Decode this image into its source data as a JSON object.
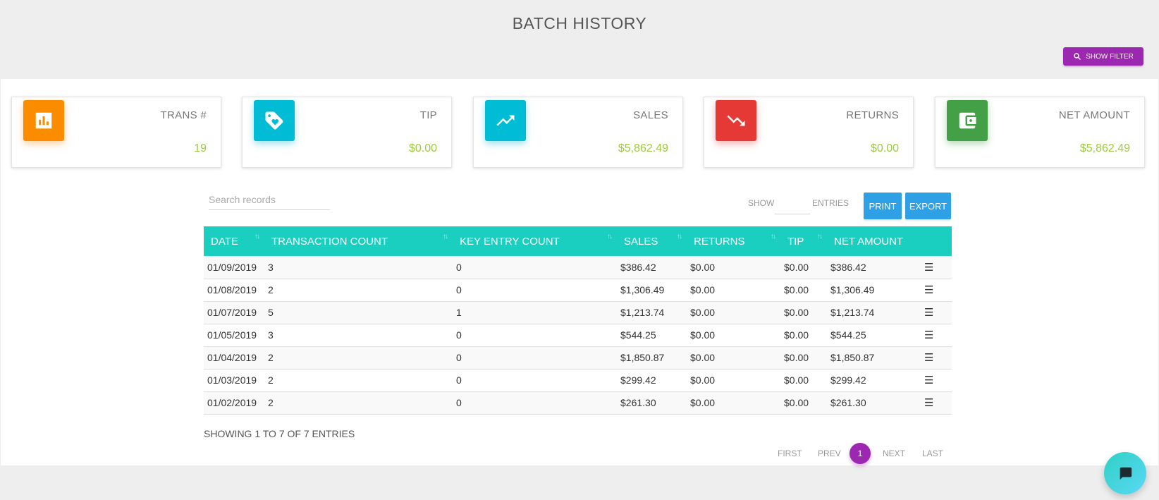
{
  "header": {
    "title": "BATCH HISTORY",
    "filter_button": "SHOW FILTER"
  },
  "cards": [
    {
      "label": "TRANS #",
      "value": "19",
      "icon": "bar-chart-icon",
      "color": "#fb8c00"
    },
    {
      "label": "TIP",
      "value": "$0.00",
      "icon": "tag-heart-icon",
      "color": "#00bcd4"
    },
    {
      "label": "SALES",
      "value": "$5,862.49",
      "icon": "trending-up-icon",
      "color": "#00bcd4"
    },
    {
      "label": "RETURNS",
      "value": "$0.00",
      "icon": "trending-down-icon",
      "color": "#e53935"
    },
    {
      "label": "NET AMOUNT",
      "value": "$5,862.49",
      "icon": "wallet-icon",
      "color": "#43a047"
    }
  ],
  "toolbar": {
    "search_placeholder": "Search records",
    "show_label": "SHOW",
    "entries_label": "ENTRIES",
    "print_label": "PRINT",
    "export_label": "EXPORT"
  },
  "table": {
    "columns": [
      "DATE",
      "TRANSACTION COUNT",
      "KEY ENTRY COUNT",
      "SALES",
      "RETURNS",
      "TIP",
      "NET AMOUNT"
    ],
    "rows": [
      [
        "01/09/2019",
        "3",
        "0",
        "$386.42",
        "$0.00",
        "$0.00",
        "$386.42"
      ],
      [
        "01/08/2019",
        "2",
        "0",
        "$1,306.49",
        "$0.00",
        "$0.00",
        "$1,306.49"
      ],
      [
        "01/07/2019",
        "5",
        "1",
        "$1,213.74",
        "$0.00",
        "$0.00",
        "$1,213.74"
      ],
      [
        "01/05/2019",
        "3",
        "0",
        "$544.25",
        "$0.00",
        "$0.00",
        "$544.25"
      ],
      [
        "01/04/2019",
        "2",
        "0",
        "$1,850.87",
        "$0.00",
        "$0.00",
        "$1,850.87"
      ],
      [
        "01/03/2019",
        "2",
        "0",
        "$299.42",
        "$0.00",
        "$0.00",
        "$299.42"
      ],
      [
        "01/02/2019",
        "2",
        "0",
        "$261.30",
        "$0.00",
        "$0.00",
        "$261.30"
      ]
    ],
    "row_menu_glyph": "☰"
  },
  "footer": {
    "showing_text": "SHOWING 1 TO 7 OF 7 ENTRIES",
    "first": "FIRST",
    "prev": "PREV",
    "current_page": "1",
    "next": "NEXT",
    "last": "LAST"
  },
  "colors": {
    "accent_purple": "#9c27b0",
    "table_header": "#1bcfc0",
    "button_blue": "#2ea1e6",
    "value_green": "#9ccc3c"
  }
}
